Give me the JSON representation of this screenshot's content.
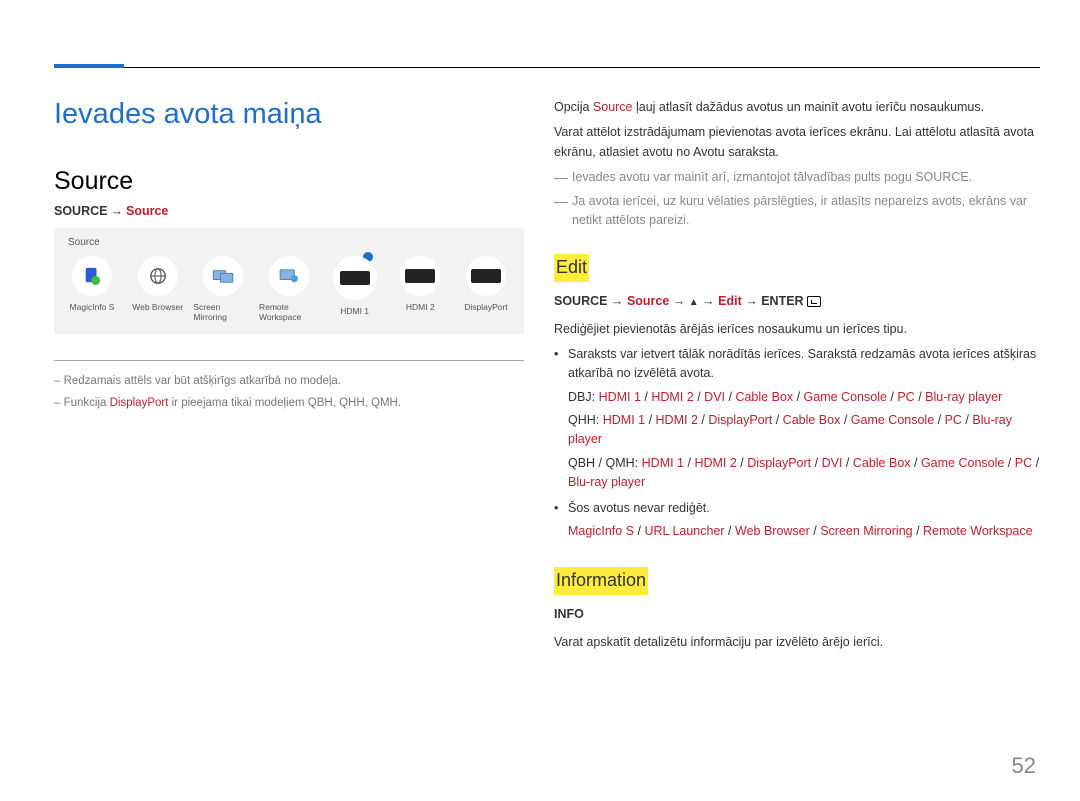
{
  "page_number": "52",
  "page_title": "Ievades avota maiņa",
  "left": {
    "section_title": "Source",
    "path_prefix": "SOURCE",
    "path_source": "Source",
    "panel_title": "Source",
    "sources": [
      "MagicInfo S",
      "Web Browser",
      "Screen Mirroring",
      "Remote Workspace",
      "HDMI 1",
      "HDMI 2",
      "DisplayPort"
    ],
    "note1_pre": "–  Redzamais attēls var būt atšķirīgs atkarībā no modeļa.",
    "note2_pre": "–  Funkcija ",
    "note2_red": "DisplayPort",
    "note2_post": " ir pieejama tikai modeļiem QBH, QHH, QMH."
  },
  "right": {
    "p1_pre": "Opcija ",
    "p1_src": "Source",
    "p1_post": " ļauj atlasīt dažādus avotus un mainīt avotu ierīču nosaukumus.",
    "p2": "Varat attēlot izstrādājumam pievienotas avota ierīces ekrānu. Lai attēlotu atlasītā avota ekrānu, atlasiet avotu no Avotu saraksta.",
    "d1": "Ievades avotu var mainīt arī, izmantojot tālvadības pults pogu SOURCE.",
    "d2": "Ja avota ierīcei, uz kuru vēlaties pārslēgties, ir atlasīts nepareizs avots, ekrāns var netikt attēlots pareizi.",
    "edit_h": "Edit",
    "edit_path_pre": "SOURCE",
    "edit_path_src": "Source",
    "edit_path_edit": "Edit",
    "edit_path_enter": "ENTER",
    "edit_desc": "Rediģējiet pievienotās ārējās ierīces nosaukumu un ierīces tipu.",
    "bul1": "Saraksts var ietvert tālāk norādītās ierīces. Sarakstā redzamās avota ierīces atšķiras atkarībā no izvēlētā avota.",
    "dbj_label": "DBJ:",
    "dbj": [
      "HDMI 1",
      "HDMI 2",
      "DVI",
      "Cable Box",
      "Game Console",
      "PC",
      "Blu-ray player"
    ],
    "qhh_label": "QHH:",
    "qhh": [
      "HDMI 1",
      "HDMI 2",
      "DisplayPort",
      "Cable Box",
      "Game Console",
      "PC",
      "Blu-ray player"
    ],
    "qbh_label": "QBH / QMH:",
    "qbh": [
      "HDMI 1",
      "HDMI 2",
      "DisplayPort",
      "DVI",
      "Cable Box",
      "Game Console",
      "PC",
      "Blu-ray player"
    ],
    "bul2": "Šos avotus nevar rediģēt.",
    "noedit": [
      "MagicInfo S",
      "URL Launcher",
      "Web Browser",
      "Screen Mirroring",
      "Remote Workspace"
    ],
    "info_h": "Information",
    "info_label": "INFO",
    "info_desc": "Varat apskatīt detalizētu informāciju par izvēlēto ārējo ierīci."
  }
}
